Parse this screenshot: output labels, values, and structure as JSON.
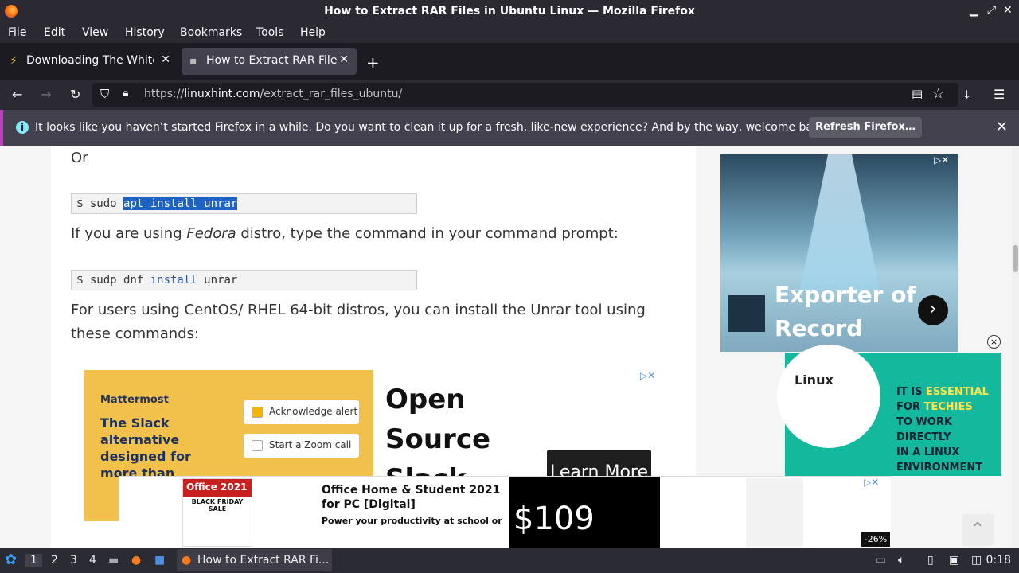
{
  "window": {
    "title": "How to Extract RAR Files in Ubuntu Linux — Mozilla Firefox"
  },
  "menu": [
    "File",
    "Edit",
    "View",
    "History",
    "Bookmarks",
    "Tools",
    "Help"
  ],
  "tabs": [
    {
      "label": "Downloading The White",
      "active": false
    },
    {
      "label": "How to Extract RAR Files",
      "active": true
    }
  ],
  "nav": {
    "url_prefix": "https://",
    "url_domain": "linuxhint.com",
    "url_path": "/extract_rar_files_ubuntu/"
  },
  "notification": {
    "message": "It looks like you haven’t started Firefox in a while. Do you want to clean it up for a fresh, like-new experience? And by the way, welcome back!",
    "button": "Refresh Firefox…"
  },
  "article": {
    "or": "Or",
    "code1": {
      "prefix": "$ sudo ",
      "selected": "apt install unrar"
    },
    "fedora_pre": "If you are using ",
    "fedora_em": "Fedora",
    "fedora_post": " distro, type the command in your command prompt:",
    "code2": {
      "pre": "$ sudp dnf ",
      "kw": "install",
      "post": " unrar"
    },
    "centos_line1": "For users using CentOS/ RHEL 64-bit distros, you can install the Unrar tool using",
    "centos_line2": "these commands:"
  },
  "ads": {
    "mattermost": {
      "brand": "Mattermost",
      "headline": "The Slack alternative designed for more than",
      "card1": "Acknowledge alert",
      "card2": "Start a Zoom call",
      "big_line1": "Open",
      "big_line2": "Source",
      "big_line3": "Slack",
      "cta": "Learn More"
    },
    "exporter": {
      "line1": "Exporter of",
      "line2": "Record"
    },
    "linux": {
      "logo": "Linux",
      "l1a": "IT IS ",
      "l1b": "ESSENTIAL",
      "l2a": "FOR ",
      "l2b": "TECHIES",
      "l3": "TO WORK DIRECTLY",
      "l4": "IN A LINUX",
      "l5": "ENVIRONMENT"
    },
    "office": {
      "pkg_title": "Office 2021",
      "pkg_badge": "BLACK FRIDAY SALE",
      "title": "Office Home & Student 2021 for PC [Digital]",
      "desc": "Power your productivity at school or in y...",
      "price": "$109",
      "discount": "-26%"
    }
  },
  "taskbar": {
    "workspaces": [
      "1",
      "2",
      "3",
      "4"
    ],
    "task_label": "How to Extract RAR Fi...",
    "clock": "0:18"
  }
}
